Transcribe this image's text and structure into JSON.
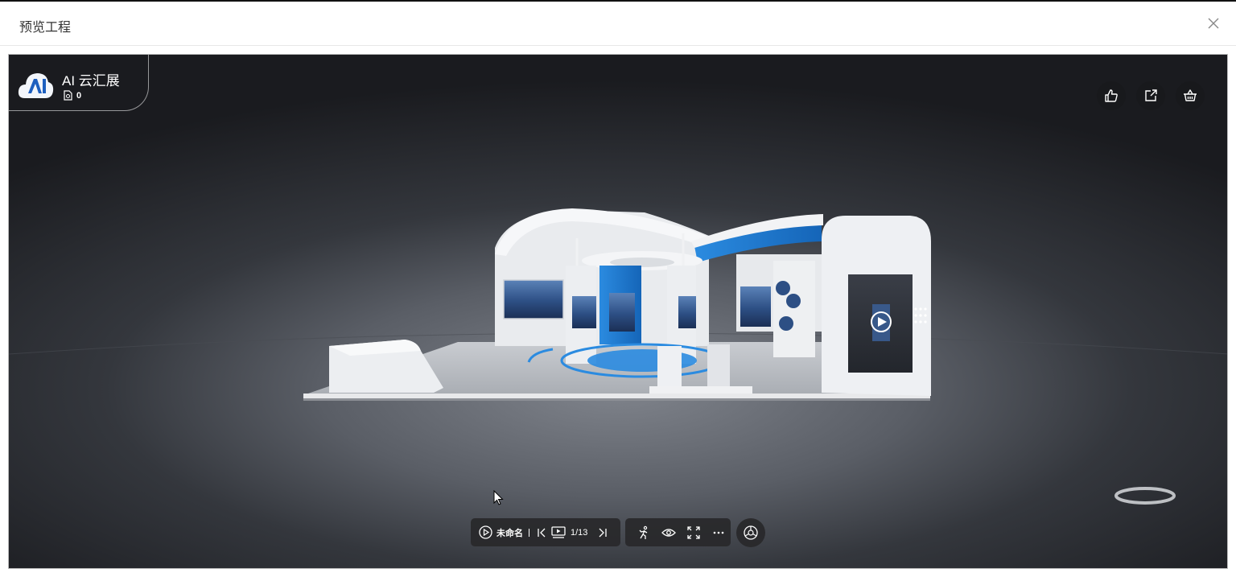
{
  "dialog": {
    "title": "预览工程"
  },
  "viewer": {
    "brand": {
      "name": "AI 云汇展",
      "count": "0"
    },
    "actions": [
      {
        "icon": "thumbs-up-icon"
      },
      {
        "icon": "share-icon"
      },
      {
        "icon": "basket-icon"
      }
    ],
    "toolbar": {
      "tour_name": "未命名",
      "page_indicator": "1/13"
    }
  },
  "colors": {
    "accent_blue": "#2b8be0",
    "panel": "#28282a"
  }
}
